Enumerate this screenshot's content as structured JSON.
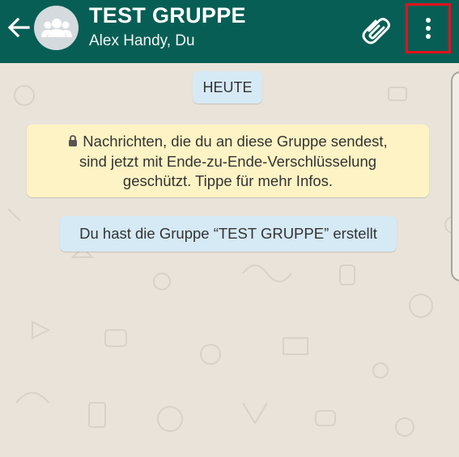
{
  "header": {
    "title": "TEST GRUPPE",
    "subtitle": "Alex Handy, Du",
    "back_icon": "arrow-left-icon",
    "avatar_icon": "group-icon",
    "attach_icon": "paperclip-icon",
    "menu_icon": "more-vertical-icon",
    "color": "#075e54",
    "highlight_color": "#e8101a"
  },
  "chat": {
    "date_chip": "HEUTE",
    "encryption_notice": {
      "icon": "lock-icon",
      "line1": "Nachrichten, die du an diese Gruppe sendest,",
      "line2": "sind jetzt mit Ende-zu-Ende-Verschlüsselung",
      "line3": "geschützt. Tippe für mehr Infos."
    },
    "system_message": "Du hast die Gruppe “TEST GRUPPE” erstellt",
    "wallpaper_color": "#e9e3da"
  }
}
